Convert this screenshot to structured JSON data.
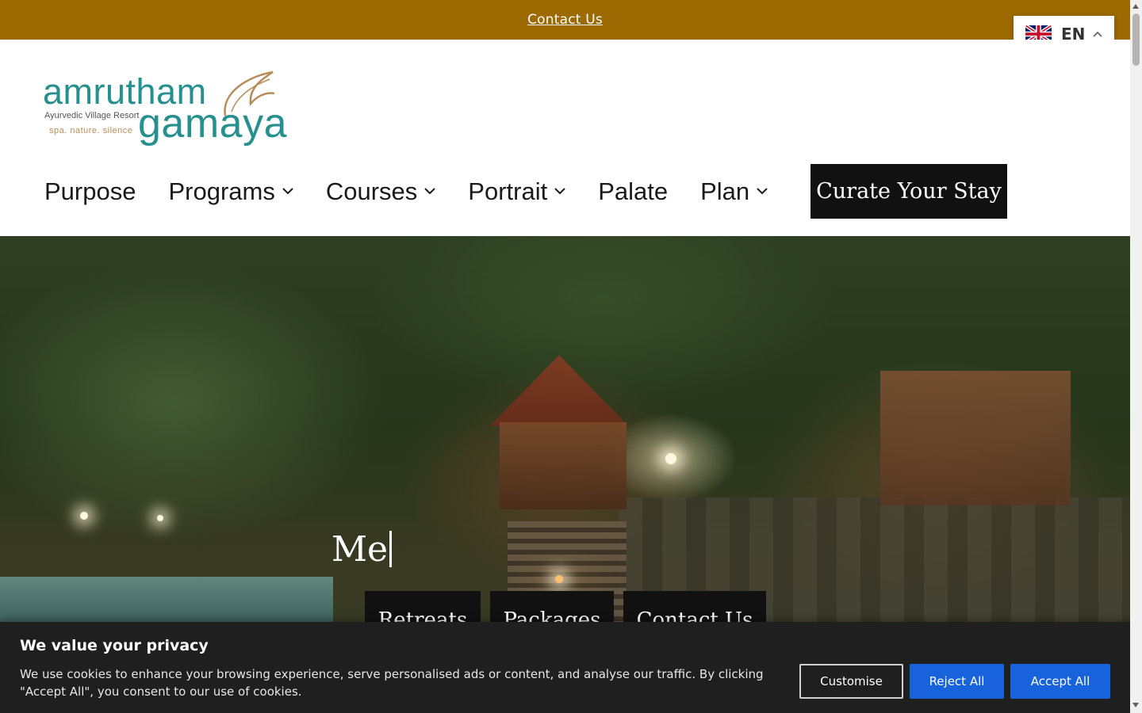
{
  "topbar": {
    "contact_link": "Contact Us",
    "bg_color": "#9c6a00"
  },
  "language": {
    "code": "EN",
    "flag_icon": "uk-flag-icon"
  },
  "logo": {
    "line1": "amrutham",
    "line2": "gamaya",
    "tagline1": "Ayurvedic Village Resort",
    "tagline2": "spa. nature. silence"
  },
  "nav": {
    "items": [
      {
        "label": "Purpose",
        "has_dropdown": false
      },
      {
        "label": "Programs",
        "has_dropdown": true
      },
      {
        "label": "Courses",
        "has_dropdown": true
      },
      {
        "label": "Portrait",
        "has_dropdown": true
      },
      {
        "label": "Palate",
        "has_dropdown": false
      },
      {
        "label": "Plan",
        "has_dropdown": true
      }
    ],
    "cta_label": "Curate Your Stay"
  },
  "hero": {
    "typed_text": "Me",
    "buttons": [
      "Retreats",
      "Packages",
      "Contact Us"
    ]
  },
  "cookie": {
    "title": "We value your privacy",
    "text": "We use cookies to enhance your browsing experience, serve personalised ads or content, and analyse our traffic. By clicking \"Accept All\", you consent to our use of cookies.",
    "customise": "Customise",
    "reject": "Reject All",
    "accept": "Accept All",
    "button_color": "#1863dc"
  }
}
